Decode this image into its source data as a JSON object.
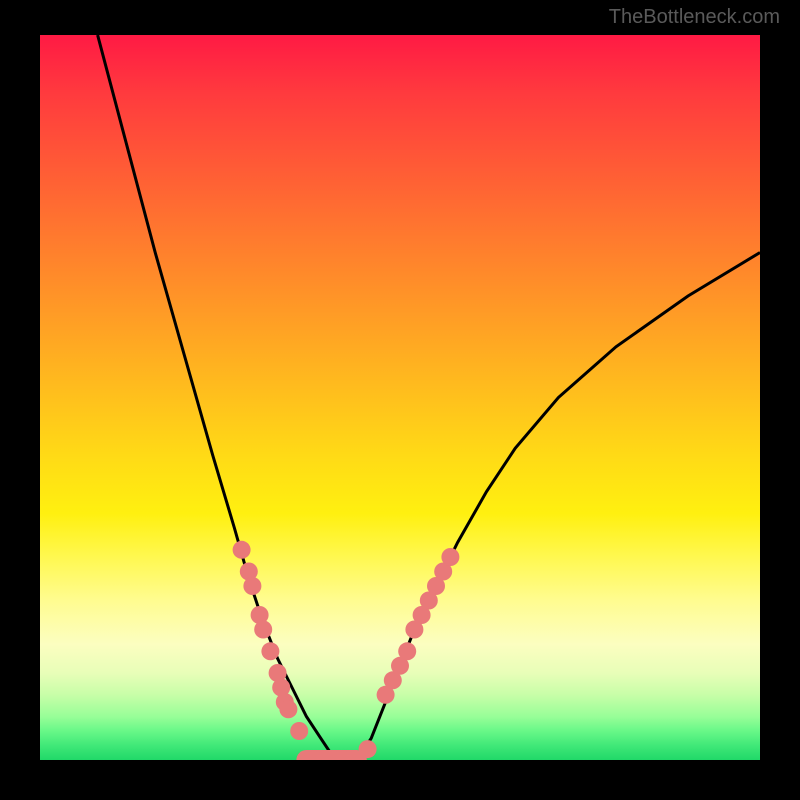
{
  "watermark": "TheBottleneck.com",
  "chart_data": {
    "type": "line",
    "title": "",
    "xlabel": "",
    "ylabel": "",
    "xlim": [
      0,
      100
    ],
    "ylim": [
      0,
      100
    ],
    "series": [
      {
        "name": "left-curve",
        "x": [
          8,
          12,
          16,
          20,
          24,
          27,
          29,
          31,
          33,
          35,
          37,
          39,
          41
        ],
        "values": [
          100,
          85,
          70,
          56,
          42,
          32,
          25,
          19,
          14,
          10,
          6,
          3,
          0
        ]
      },
      {
        "name": "right-curve",
        "x": [
          44,
          46,
          48,
          50,
          52,
          55,
          58,
          62,
          66,
          72,
          80,
          90,
          100
        ],
        "values": [
          0,
          3,
          8,
          13,
          18,
          24,
          30,
          37,
          43,
          50,
          57,
          64,
          70
        ]
      }
    ],
    "markers": [
      {
        "name": "left-cluster",
        "x": [
          28,
          29,
          29.5,
          30.5,
          31,
          32,
          33,
          33.5,
          34,
          34.5
        ],
        "y_approx": [
          29,
          26,
          24,
          20,
          18,
          15,
          12,
          10,
          8,
          7
        ]
      },
      {
        "name": "right-cluster",
        "x": [
          48,
          49,
          50,
          51,
          52,
          53,
          54,
          55,
          56,
          57
        ],
        "y_approx": [
          9,
          11,
          13,
          15,
          18,
          20,
          22,
          24,
          26,
          28
        ]
      },
      {
        "name": "left-low-single",
        "x": [
          36
        ],
        "y_approx": [
          4
        ]
      },
      {
        "name": "right-start-single",
        "x": [
          45.5
        ],
        "y_approx": [
          1.5
        ]
      },
      {
        "name": "bottom-pill",
        "x_range": [
          37,
          44
        ],
        "y_approx": [
          0
        ]
      }
    ],
    "colors": {
      "curve_stroke": "#000000",
      "marker_fill": "#e97979",
      "background_top": "#ff1a44",
      "background_bottom": "#20d868"
    }
  }
}
